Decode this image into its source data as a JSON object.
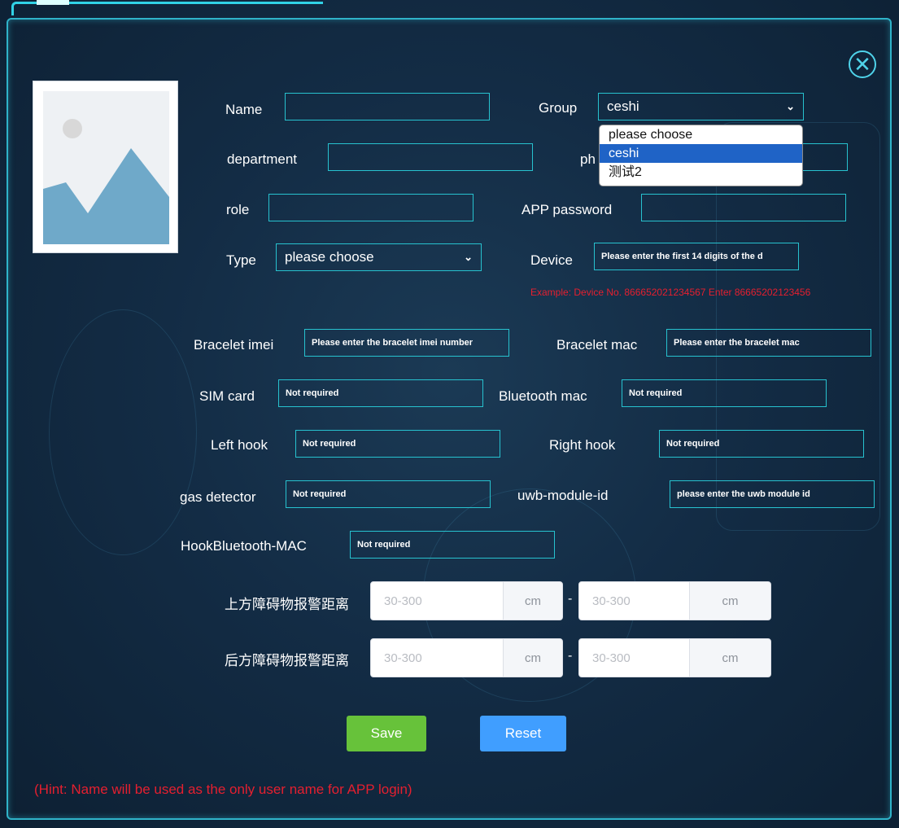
{
  "form": {
    "name_label": "Name",
    "group_label": "Group",
    "group_value": "ceshi",
    "group_options": [
      "please choose",
      "ceshi",
      "测试2"
    ],
    "department_label": "department",
    "phone_label_partial": "ph",
    "role_label": "role",
    "app_password_label": "APP password",
    "type_label": "Type",
    "type_value": "please choose",
    "device_label": "Device",
    "device_placeholder": "Please enter the first 14 digits of the d",
    "device_example": "Example: Device No. 866652021234567 Enter 86665202123456",
    "bracelet_imei_label": "Bracelet imei",
    "bracelet_imei_placeholder": "Please enter the bracelet imei number",
    "bracelet_mac_label": "Bracelet mac",
    "bracelet_mac_placeholder": "Please enter the bracelet mac",
    "sim_label": "SIM card",
    "sim_placeholder": "Not required",
    "bluetooth_mac_label": "Bluetooth mac",
    "bluetooth_mac_placeholder": "Not required",
    "left_hook_label": "Left hook",
    "left_hook_placeholder": "Not required",
    "right_hook_label": "Right hook",
    "right_hook_placeholder": "Not required",
    "gas_label": "gas detector",
    "gas_placeholder": "Not required",
    "uwb_label": "uwb-module-id",
    "uwb_placeholder": "please enter the uwb module id",
    "hook_bt_label": "HookBluetooth-MAC",
    "hook_bt_placeholder": "Not required",
    "upper_label": "上方障碍物报警距离",
    "rear_label": "后方障碍物报警距离",
    "range_placeholder": "30-300",
    "unit": "cm",
    "dash": "-",
    "save_label": "Save",
    "reset_label": "Reset",
    "hint": "(Hint: Name will be used as the only user name for APP login)"
  },
  "colors": {
    "accent": "#27c2cf",
    "save": "#67c23a",
    "reset": "#409eff",
    "warning": "#e51f2f"
  }
}
